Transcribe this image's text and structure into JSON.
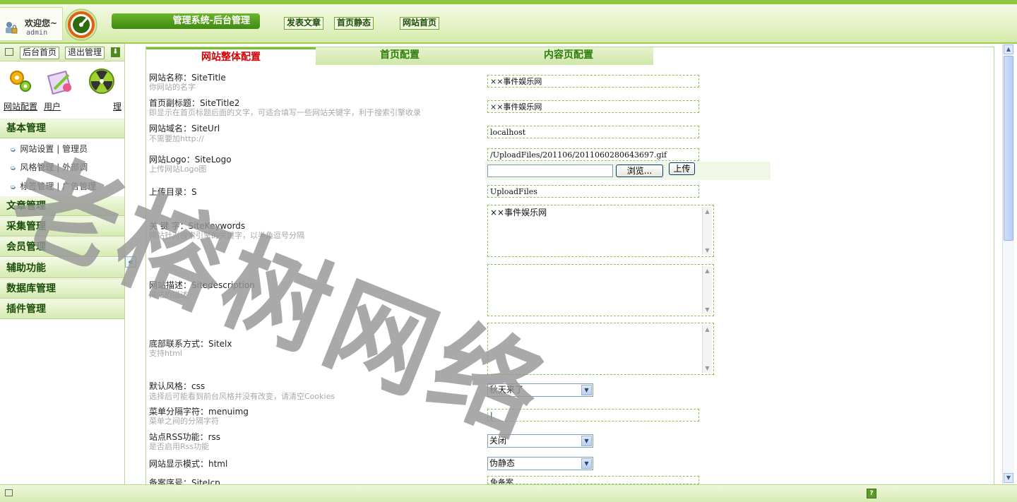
{
  "header": {
    "welcome": "欢迎您~",
    "user": "admin",
    "system_title": "管理系统-后台管理",
    "links": [
      "发表文章",
      "首页静态",
      "网站首页"
    ]
  },
  "sidebar": {
    "toolbar": {
      "home": "后台首页",
      "logout": "退出管理"
    },
    "icons": [
      {
        "label": "网站配置",
        "icon": "gears-icon"
      },
      {
        "label": "用户",
        "icon": "user-tools-icon"
      },
      {
        "label": "理",
        "icon": "radiation-icon"
      }
    ],
    "sections": [
      "基本管理",
      "文章管理",
      "采集管理",
      "会员管理",
      "辅助功能",
      "数据库管理",
      "插件管理"
    ],
    "basic_items": [
      "网站设置 | 管理员",
      "风格管理 | 外部调",
      "标签管理 | 广告管理"
    ]
  },
  "tabs": [
    "网站整体配置",
    "首页配置",
    "内容页配置"
  ],
  "form": {
    "site_title": {
      "label": "网站名称：SiteTitle",
      "desc": "你网站的名字",
      "value": "××事件娱乐网"
    },
    "site_title2": {
      "label": "首页副标题：SiteTitle2",
      "desc": "即显示在首页标题后面的文字，可适合填写一些网站关键字，利于搜索引擎收录",
      "value": "××事件娱乐网"
    },
    "site_url": {
      "label": "网站域名：SiteUrl",
      "desc": "不需要加http://",
      "value": "localhost"
    },
    "site_logo": {
      "label": "网站Logo：SiteLogo",
      "desc": "上传网站Logo图",
      "value": "/UploadFiles/201106/2011060280643697.gif"
    },
    "upload_dir": {
      "label": "上传目录：S",
      "value": "UploadFiles"
    },
    "keywords": {
      "label": "关 键 字：SiteKeywords",
      "desc": "网站针对搜索引擎的关键字，以半角逗号分隔",
      "value": "××事件娱乐网"
    },
    "description": {
      "label": "网站描述：Sitedescription",
      "desc": "网站的描述",
      "value": ""
    },
    "contact": {
      "label": "底部联系方式：Sitelx",
      "desc": "支持html",
      "value": ""
    },
    "css": {
      "label": "默认风格：css",
      "desc": "选择后可能看到前台风格并没有改变，请清空Cookies",
      "value": "秋天来了"
    },
    "menuimg": {
      "label": "菜单分隔字符：menuimg",
      "desc": "菜单之间的分隔字符",
      "value": "|"
    },
    "rss": {
      "label": "站点RSS功能：rss",
      "desc": "是否启用Rss功能",
      "value": "关闭"
    },
    "html": {
      "label": "网站显示模式：html",
      "value": "伪静态"
    },
    "icp": {
      "label": "备案序号：SiteIcp",
      "value": "免备案"
    },
    "browse_btn": "浏览...",
    "upload_btn": "上传"
  },
  "watermark": "老榕树网络"
}
